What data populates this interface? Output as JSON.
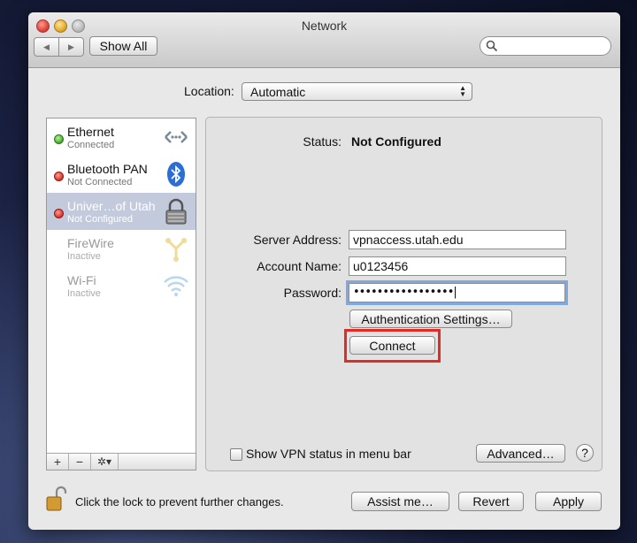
{
  "window": {
    "title": "Network"
  },
  "toolbar": {
    "back_glyph": "◀",
    "forward_glyph": "▶",
    "show_all_label": "Show All",
    "search_placeholder": ""
  },
  "location": {
    "label": "Location:",
    "value": "Automatic"
  },
  "services": [
    {
      "name": "Ethernet",
      "status": "Connected",
      "dot": "green",
      "icon": "ethernet-icon"
    },
    {
      "name": "Bluetooth PAN",
      "status": "Not Connected",
      "dot": "red",
      "icon": "bluetooth-icon"
    },
    {
      "name": "Univer…of Utah",
      "status": "Not Configured",
      "dot": "red",
      "icon": "vpn-lock-icon",
      "selected": true
    },
    {
      "name": "FireWire",
      "status": "Inactive",
      "dot": "none",
      "icon": "firewire-icon"
    },
    {
      "name": "Wi-Fi",
      "status": "Inactive",
      "dot": "none",
      "icon": "wifi-icon"
    }
  ],
  "sidebar_buttons": {
    "add": "+",
    "remove": "−",
    "action": "✲▾"
  },
  "detail": {
    "status_label": "Status:",
    "status_value": "Not Configured",
    "server_label": "Server Address:",
    "server_value": "vpnaccess.utah.edu",
    "account_label": "Account Name:",
    "account_value": "u0123456",
    "password_label": "Password:",
    "password_value": "•••••••••••••••••",
    "auth_button": "Authentication Settings…",
    "connect_button": "Connect",
    "show_vpn_label": "Show VPN status in menu bar",
    "advanced_button": "Advanced…",
    "help_button": "?"
  },
  "footer": {
    "lock_text": "Click the lock to prevent further changes.",
    "assist_button": "Assist me…",
    "revert_button": "Revert",
    "apply_button": "Apply"
  },
  "colors": {
    "selection": "#c2cadc",
    "highlight_box": "#e32b23",
    "focus_ring": "#7fa9e0"
  }
}
